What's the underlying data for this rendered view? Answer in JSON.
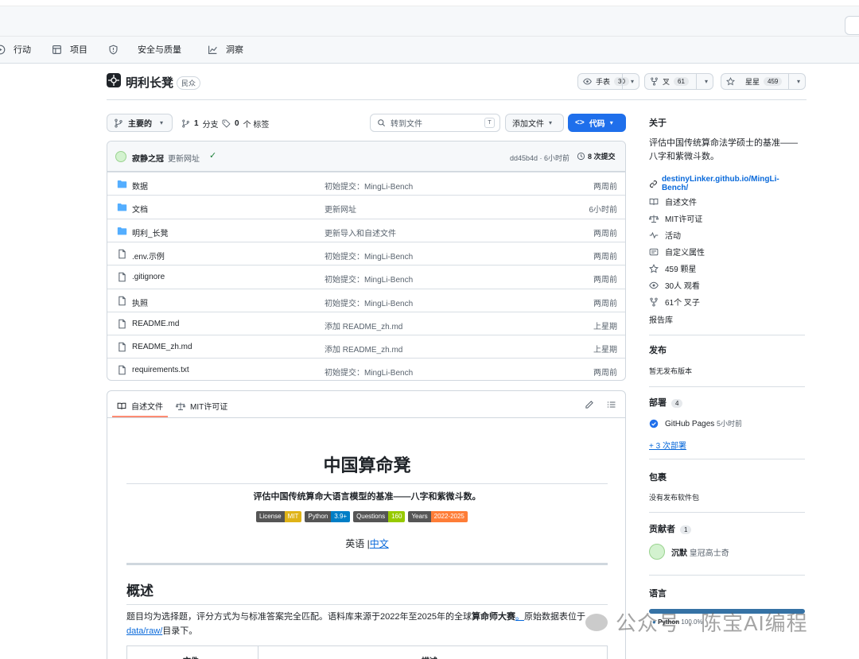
{
  "nav": {
    "items": [
      {
        "label": "行动",
        "icon": "play-circle-icon"
      },
      {
        "label": "项目",
        "icon": "table-icon"
      },
      {
        "label": "安全与质量",
        "icon": "shield-icon"
      },
      {
        "label": "洞察",
        "icon": "graph-icon"
      }
    ]
  },
  "repo": {
    "name": "明利长凳",
    "visibility": "民众",
    "watch": {
      "label": "手表",
      "count": "30"
    },
    "fork": {
      "label": "叉",
      "count": "61"
    },
    "star": {
      "label": "星星",
      "count": "459"
    }
  },
  "toolbar": {
    "branch": "主要的",
    "branches_count": "1",
    "branches_label": "分支",
    "tags_count": "0",
    "tags_label": "个 标签",
    "search_placeholder": "转到文件",
    "search_key": "T",
    "add_file": "添加文件",
    "code": "代码"
  },
  "commit": {
    "author": "寂静之冠",
    "message": "更新网址",
    "hash_time": "dd45b4d · 6小时前",
    "count": "8 次提交"
  },
  "files": [
    {
      "type": "folder",
      "name": "数据",
      "message": "初始提交：MingLi-Bench",
      "time": "两周前"
    },
    {
      "type": "folder",
      "name": "文档",
      "message": "更新网址",
      "time": "6小时前"
    },
    {
      "type": "folder",
      "name": "明利_长凳",
      "message": "更新导入和自述文件",
      "time": "两周前"
    },
    {
      "type": "file",
      "name": ".env.示例",
      "message": "初始提交：MingLi-Bench",
      "time": "两周前"
    },
    {
      "type": "file",
      "name": ".gitignore",
      "message": "初始提交：MingLi-Bench",
      "time": "两周前"
    },
    {
      "type": "file",
      "name": "执照",
      "message": "初始提交：MingLi-Bench",
      "time": "两周前"
    },
    {
      "type": "file",
      "name": "README.md",
      "message": "添加 README_zh.md",
      "time": "上星期"
    },
    {
      "type": "file",
      "name": "README_zh.md",
      "message": "添加 README_zh.md",
      "time": "上星期"
    },
    {
      "type": "file",
      "name": "requirements.txt",
      "message": "初始提交：MingLi-Bench",
      "time": "两周前"
    }
  ],
  "readme": {
    "tab_readme": "自述文件",
    "tab_license": "MIT许可证",
    "title": "中国算命凳",
    "subtitle": "评估中国传统算命大语言模型的基准——八字和紫微斗数。",
    "shields": [
      {
        "left": "License",
        "right": "MIT",
        "color": "#dfb317"
      },
      {
        "left": "Python",
        "right": "3.9+",
        "color": "#007ec6"
      },
      {
        "left": "Questions",
        "right": "160",
        "color": "#97ca00"
      },
      {
        "left": "Years",
        "right": "2022-2025",
        "color": "#fe7d37"
      }
    ],
    "lang_en": "英语 |",
    "lang_zh": "中文",
    "h2": "概述",
    "para_1": "题目均为选择题，评分方式为与标准答案完全匹配。语料库来源于2022年至2025年的全球",
    "para_bold": "算命师大赛",
    "para_link1": "。",
    "para_2": "原始数据表位于",
    "para_link2": "data/raw/",
    "para_3": "目录下。",
    "table_col1": "文件",
    "table_col2": "描述"
  },
  "sidebar": {
    "about_title": "关于",
    "description": "评估中国传统算命法学硕士的基准——八字和紫微斗数。",
    "homepage": "destinyLinker.github.io/MingLi-Bench/",
    "items": [
      {
        "label": "自述文件",
        "icon": "book-icon"
      },
      {
        "label": "MIT许可证",
        "icon": "scale-icon"
      },
      {
        "label": "活动",
        "icon": "pulse-icon"
      },
      {
        "label": "自定义属性",
        "icon": "note-icon"
      },
      {
        "label": "459 颗星",
        "icon": "star-icon"
      },
      {
        "label": "30人 观看",
        "icon": "eye-icon"
      },
      {
        "label": "61个 叉子",
        "icon": "fork-icon"
      }
    ],
    "report": "报告库",
    "releases_title": "发布",
    "releases_text": "暂无发布版本",
    "deploy_title": "部署",
    "deploy_count": "4",
    "deploy_item": "GitHub Pages",
    "deploy_time": "5小时前",
    "deploy_more": "+ 3 次部署",
    "packages_title": "包裹",
    "packages_text": "没有发布软件包",
    "contrib_title": "贡献者",
    "contrib_count": "1",
    "contrib_name": "沉默",
    "contrib_fullname": "皇冠高士奇",
    "lang_title": "语言",
    "lang_name": "Python",
    "lang_pct": "100.0%"
  },
  "watermark": "公众号 · 陈宝AI编程",
  "colors": {
    "accent": "#1f6feb",
    "folder": "#54aeff",
    "link": "#0969da"
  }
}
